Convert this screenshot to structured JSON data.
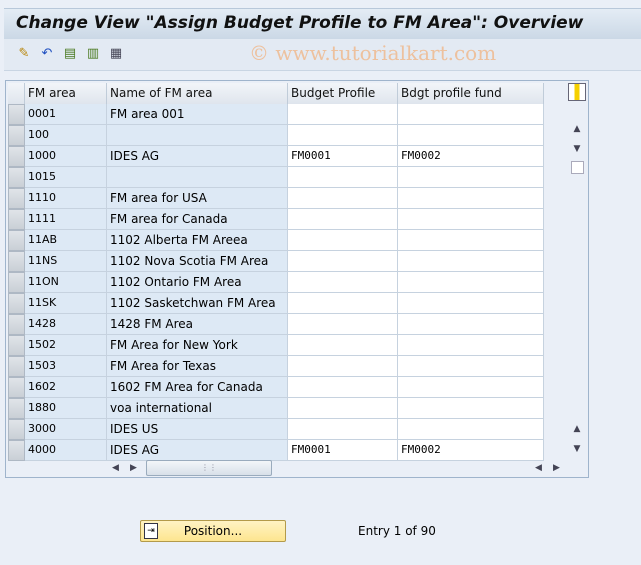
{
  "title": "Change View \"Assign Budget Profile to FM Area\": Overview",
  "watermark": "© www.tutorialkart.com",
  "toolbar": [
    {
      "icon": "edit-pencil-icon",
      "glyph": "✎"
    },
    {
      "icon": "undo-icon",
      "glyph": "↶"
    },
    {
      "icon": "select-all-icon",
      "glyph": "▤"
    },
    {
      "icon": "select-block-icon",
      "glyph": "▥"
    },
    {
      "icon": "deselect-all-icon",
      "glyph": "▦"
    }
  ],
  "table": {
    "columns": [
      "FM area",
      "Name of FM area",
      "Budget Profile",
      "Bdgt profile fund"
    ],
    "rows": [
      [
        "0001",
        "FM area 001",
        "",
        ""
      ],
      [
        "100",
        "",
        "",
        ""
      ],
      [
        "1000",
        "IDES AG",
        "FM0001",
        "FM0002"
      ],
      [
        "1015",
        "",
        "",
        ""
      ],
      [
        "1110",
        "FM area for USA",
        "",
        ""
      ],
      [
        "1111",
        "FM area for Canada",
        "",
        ""
      ],
      [
        "11AB",
        "1102 Alberta FM Areea",
        "",
        ""
      ],
      [
        "11NS",
        "1102 Nova Scotia FM Area",
        "",
        ""
      ],
      [
        "11ON",
        "1102 Ontario FM Area",
        "",
        ""
      ],
      [
        "11SK",
        "1102 Sasketchwan FM Area",
        "",
        ""
      ],
      [
        "1428",
        "1428 FM Area",
        "",
        ""
      ],
      [
        "1502",
        "FM Area for New York",
        "",
        ""
      ],
      [
        "1503",
        "FM Area for Texas",
        "",
        ""
      ],
      [
        "1602",
        "1602 FM Area for Canada",
        "",
        ""
      ],
      [
        "1880",
        "voa international",
        "",
        ""
      ],
      [
        "3000",
        "IDES US",
        "",
        ""
      ],
      [
        "4000",
        "IDES AG",
        "FM0001",
        "FM0002"
      ]
    ]
  },
  "position_button": "Position...",
  "entry_text": "Entry 1 of 90"
}
